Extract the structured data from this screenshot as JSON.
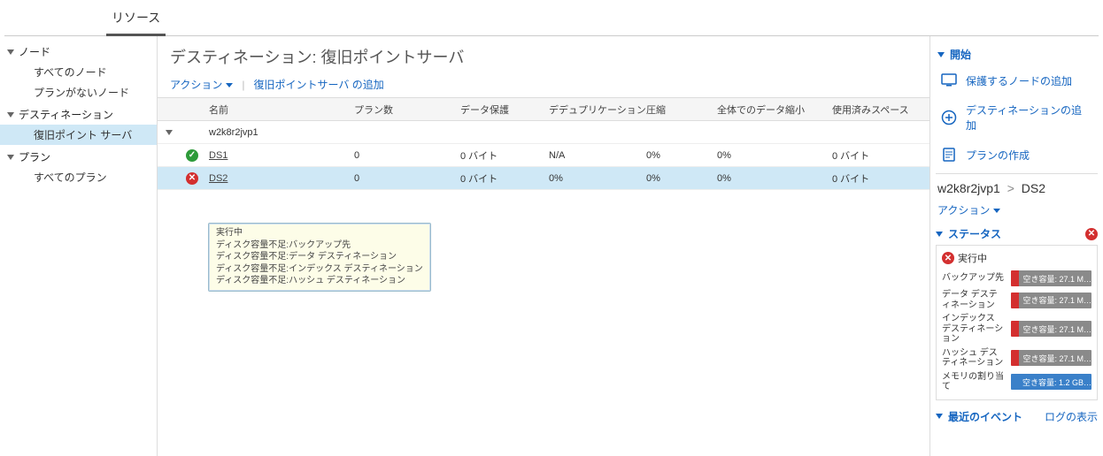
{
  "topTab": "リソース",
  "sidebar": {
    "groups": [
      {
        "label": "ノード",
        "items": [
          "すべてのノード",
          "プランがないノード"
        ]
      },
      {
        "label": "デスティネーション",
        "items": [
          "復旧ポイント サーバ"
        ],
        "activeIndex": 0
      },
      {
        "label": "プラン",
        "items": [
          "すべてのプラン"
        ]
      }
    ]
  },
  "center": {
    "title": "デスティネーション: 復旧ポイントサーバ",
    "action_label": "アクション",
    "add_label": "復旧ポイントサーバ の追加",
    "columns": {
      "name": "名前",
      "plan": "プラン数",
      "protect": "データ保護",
      "dedup": "デデュプリケーション",
      "comp": "圧縮",
      "reduce": "全体でのデータ縮小",
      "used": "使用済みスペース"
    },
    "server_row": {
      "name": "w2k8r2jvp1"
    },
    "rows": [
      {
        "status": "ok",
        "name": "DS1",
        "plan": "0",
        "protect": "0 バイト",
        "dedup": "N/A",
        "comp": "0%",
        "reduce": "0%",
        "used": "0 バイト"
      },
      {
        "status": "err",
        "name": "DS2",
        "plan": "0",
        "protect": "0 バイト",
        "dedup": "0%",
        "comp": "0%",
        "reduce": "0%",
        "used": "0 バイト"
      }
    ],
    "tooltip": {
      "l0": "実行中",
      "l1": "ディスク容量不足:バックアップ先",
      "l2": "ディスク容量不足:データ デスティネーション",
      "l3": "ディスク容量不足:インデックス デスティネーション",
      "l4": "ディスク容量不足:ハッシュ デスティネーション"
    }
  },
  "right": {
    "start": "開始",
    "quick": [
      {
        "icon": "monitor",
        "label": "保護するノードの追加"
      },
      {
        "icon": "plus",
        "label": "デスティネーションの追加"
      },
      {
        "icon": "doc",
        "label": "プランの作成"
      }
    ],
    "crumb_a": "w2k8r2jvp1",
    "crumb_sep": ">",
    "crumb_b": "DS2",
    "action_label": "アクション",
    "status_head": "ステータス",
    "running": "実行中",
    "rows": [
      {
        "label": "バックアップ先",
        "badge": "空き容量: 27.1 M…",
        "kind": "red"
      },
      {
        "label": "データ デスティネーション",
        "badge": "空き容量: 27.1 M…",
        "kind": "red"
      },
      {
        "label": "インデックス デスティネーション",
        "badge": "空き容量: 27.1 M…",
        "kind": "red"
      },
      {
        "label": "ハッシュ デスティネーション",
        "badge": "空き容量: 27.1 M…",
        "kind": "red"
      },
      {
        "label": "メモリの割り当て",
        "badge": "空き容量: 1.2 GB…",
        "kind": "blue"
      }
    ],
    "recent": "最近のイベント",
    "log_link": "ログの表示"
  }
}
